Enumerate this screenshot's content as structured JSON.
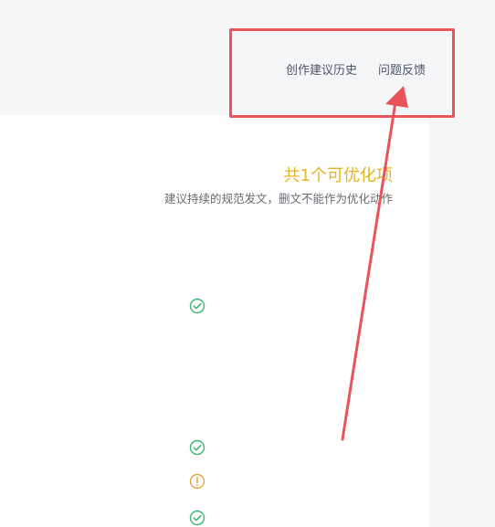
{
  "header": {
    "links": [
      {
        "label": "创作建议历史"
      },
      {
        "label": "问题反馈"
      }
    ]
  },
  "summary": {
    "title": "共1个可优化项",
    "subtitle": "建议持续的规范发文，删文不能作为优化动作"
  },
  "status_items": [
    {
      "status": "pass",
      "icon": "check-circle-icon",
      "color": "#3cb371"
    },
    {
      "status": "pass",
      "icon": "check-circle-icon",
      "color": "#3cb371"
    },
    {
      "status": "warning",
      "icon": "exclamation-circle-icon",
      "color": "#e8a640"
    },
    {
      "status": "pass",
      "icon": "check-circle-icon",
      "color": "#3cb371"
    }
  ],
  "colors": {
    "accent_title": "#e5b422",
    "annotation": "#e8545a",
    "pass": "#3cb371",
    "warning": "#e8a640"
  }
}
